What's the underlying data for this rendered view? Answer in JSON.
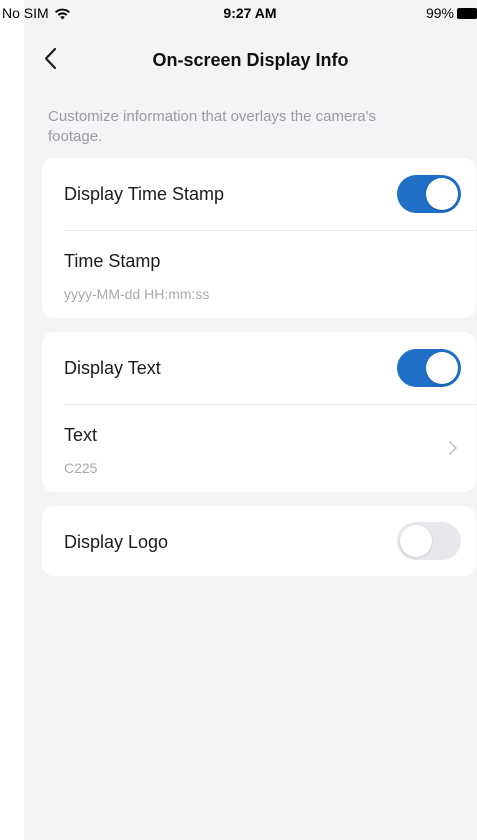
{
  "status_bar": {
    "carrier": "No SIM",
    "time": "9:27 AM",
    "battery": "99%",
    "icons": [
      "wifi-icon",
      "battery-icon"
    ]
  },
  "nav": {
    "title": "On-screen Display Info",
    "back_icon": "chevron-left-icon"
  },
  "description": "Customize information that overlays the camera's footage.",
  "sections": [
    {
      "toggle_label": "Display Time Stamp",
      "toggle_on": true,
      "detail_label": "Time Stamp",
      "detail_value": "yyyy-MM-dd HH:mm:ss"
    },
    {
      "toggle_label": "Display Text",
      "toggle_on": true,
      "detail_label": "Text",
      "detail_value": "C225",
      "detail_icon": "chevron-right-icon"
    },
    {
      "toggle_label": "Display Logo",
      "toggle_on": false
    }
  ],
  "colors": {
    "accent": "#1f6fc6",
    "toggle_off": "#e8e8ec",
    "background": "#f4f4f6",
    "secondary_text": "#9a9aa0"
  }
}
